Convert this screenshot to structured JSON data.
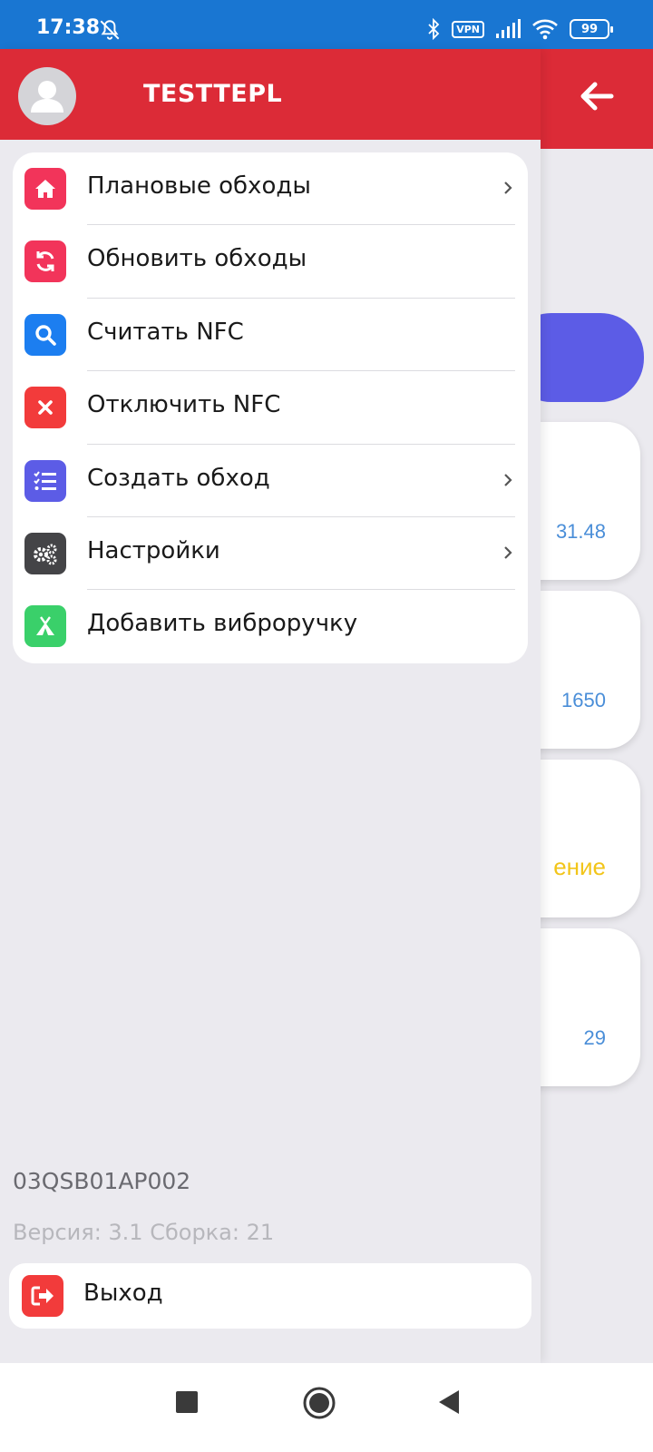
{
  "status_bar": {
    "time": "17:38",
    "vpn_label": "VPN",
    "battery_level": "99"
  },
  "background_screen": {
    "card_values": [
      "31.48",
      "1650",
      "ение",
      "29"
    ]
  },
  "drawer": {
    "username": "TESTTEPL",
    "menu": [
      {
        "label": "Плановые обходы",
        "icon": "home-icon",
        "color": "#f2345a",
        "chevron": true
      },
      {
        "label": "Обновить обходы",
        "icon": "refresh-icon",
        "color": "#f2345a",
        "chevron": false
      },
      {
        "label": "Считать NFC",
        "icon": "search-icon",
        "color": "#1c7ef0",
        "chevron": false
      },
      {
        "label": "Отключить NFC",
        "icon": "close-icon",
        "color": "#f23b3b",
        "chevron": false
      },
      {
        "label": "Создать обход",
        "icon": "checklist-icon",
        "color": "#5c5ce6",
        "chevron": true
      },
      {
        "label": "Настройки",
        "icon": "gears-icon",
        "color": "#444447",
        "chevron": true
      },
      {
        "label": "Добавить виброручку",
        "icon": "tent-icon",
        "color": "#3ad06a",
        "chevron": false
      }
    ],
    "device_id": "03QSB01AP002",
    "version": "Версия: 3.1 Сборка: 21",
    "logout_label": "Выход"
  },
  "colors": {
    "header_red": "#dc2b37",
    "status_blue": "#1976d2",
    "accent_purple": "#5c5ce6"
  }
}
